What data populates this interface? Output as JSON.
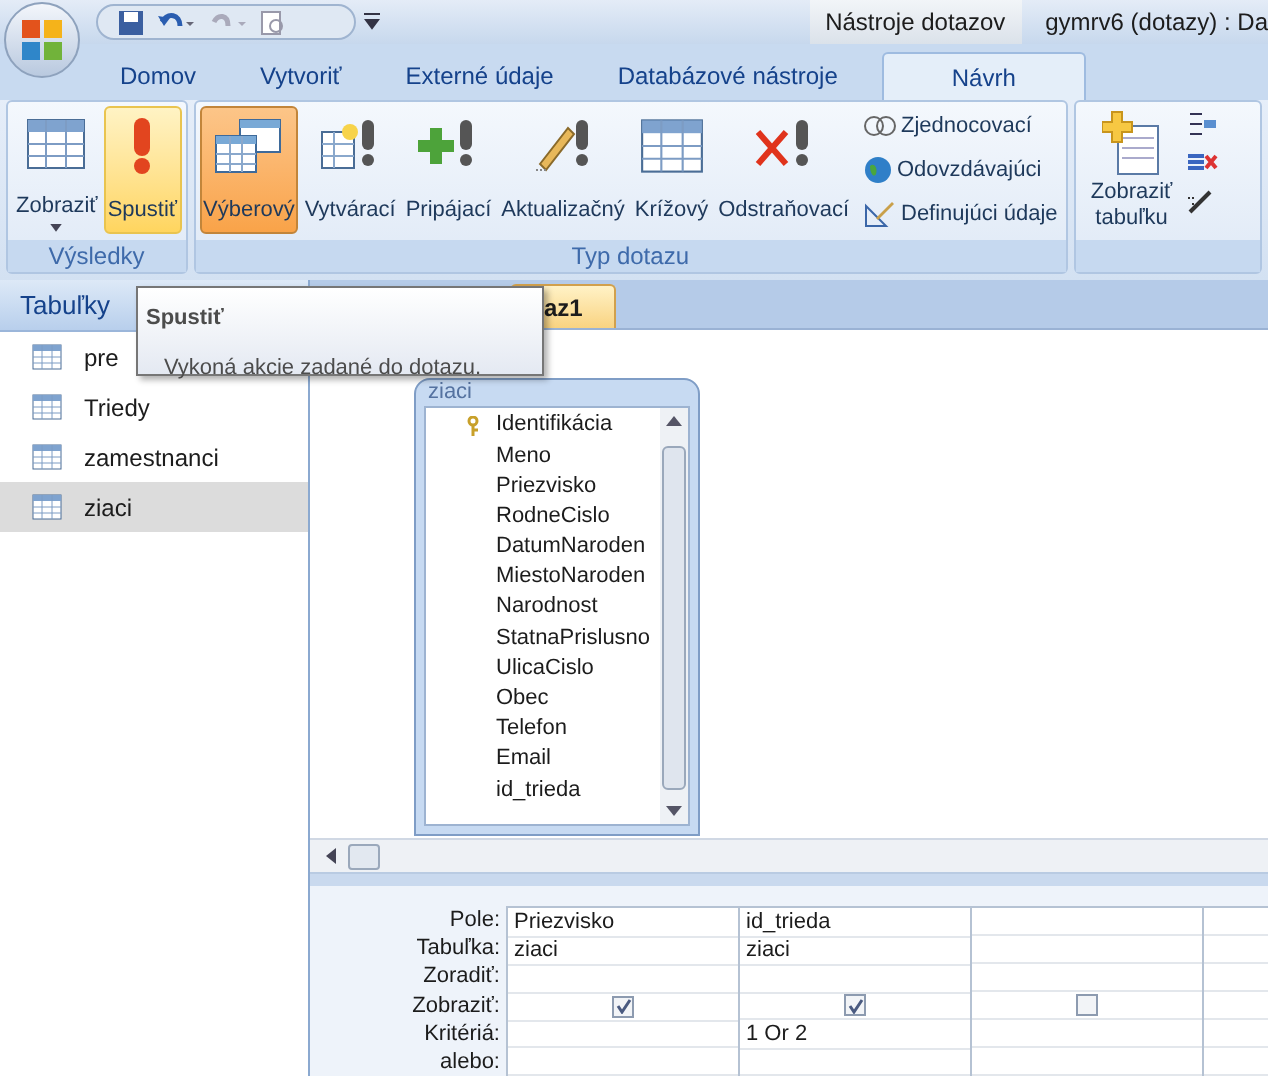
{
  "title_bar": {
    "contextual_label": "Nástroje dotazov",
    "title": "gymrv6 (dotazy) : Da"
  },
  "ribbon_tabs": [
    {
      "label": "Domov",
      "selected": false
    },
    {
      "label": "Vytvoriť",
      "selected": false
    },
    {
      "label": "Externé údaje",
      "selected": false
    },
    {
      "label": "Databázové nástroje",
      "selected": false
    },
    {
      "label": "Návrh",
      "selected": true
    }
  ],
  "ribbon_groups": [
    {
      "label": "Výsledky",
      "buttons": [
        {
          "label": "Zobraziť",
          "hovered": false,
          "pressed": false,
          "dropdown": true
        },
        {
          "label": "Spustiť",
          "hovered": true,
          "pressed": false,
          "dropdown": false
        }
      ]
    },
    {
      "label": "Typ dotazu",
      "buttons": [
        {
          "label": "Výberový",
          "hovered": false,
          "pressed": true,
          "dropdown": false
        },
        {
          "label": "Vytvárací",
          "hovered": false,
          "pressed": false,
          "dropdown": false
        },
        {
          "label": "Pripájací",
          "hovered": false,
          "pressed": false,
          "dropdown": false
        },
        {
          "label": "Aktualizačný",
          "hovered": false,
          "pressed": false,
          "dropdown": false
        },
        {
          "label": "Krížový",
          "hovered": false,
          "pressed": false,
          "dropdown": false
        },
        {
          "label": "Odstraňovací",
          "hovered": false,
          "pressed": false,
          "dropdown": false
        }
      ],
      "small_buttons": [
        "Zjednocovací",
        "Odovzdávajúci",
        "Definujúci údaje"
      ]
    },
    {
      "buttons": [
        {
          "label": "Zobraziť tabuľku",
          "hovered": false,
          "pressed": false,
          "dropdown": false
        }
      ]
    }
  ],
  "navigation_pane": {
    "header": "Tabuľky",
    "items": [
      {
        "label": "pre",
        "selected": false
      },
      {
        "label": "Triedy",
        "selected": false
      },
      {
        "label": "zamestnanci",
        "selected": false
      },
      {
        "label": "ziaci",
        "selected": true
      }
    ]
  },
  "document_tab": {
    "label": "az1"
  },
  "tooltip": {
    "title": "Spustiť",
    "text": "Vykoná akcie zadané do dotazu."
  },
  "field_list": {
    "title": "ziaci",
    "fields": [
      {
        "name": "Identifikácia",
        "primary_key": true
      },
      {
        "name": "Meno",
        "primary_key": false
      },
      {
        "name": "Priezvisko",
        "primary_key": false
      },
      {
        "name": "RodneCislo",
        "primary_key": false
      },
      {
        "name": "DatumNaroden",
        "primary_key": false
      },
      {
        "name": "MiestoNaroden",
        "primary_key": false
      },
      {
        "name": "Narodnost",
        "primary_key": false
      },
      {
        "name": "StatnaPrislusno",
        "primary_key": false
      },
      {
        "name": "UlicaCislo",
        "primary_key": false
      },
      {
        "name": "Obec",
        "primary_key": false
      },
      {
        "name": "Telefon",
        "primary_key": false
      },
      {
        "name": "Email",
        "primary_key": false
      },
      {
        "name": "id_trieda",
        "primary_key": false
      }
    ]
  },
  "design_grid": {
    "row_labels": [
      "Pole:",
      "Tabuľka:",
      "Zoradiť:",
      "Zobraziť:",
      "Kritériá:",
      "alebo:"
    ],
    "columns": [
      {
        "field": "Priezvisko",
        "table": "ziaci",
        "show": true
      },
      {
        "field": "id_trieda",
        "table": "ziaci",
        "show": true,
        "criteria": "1 Or 2"
      },
      {
        "show": false
      }
    ]
  }
}
